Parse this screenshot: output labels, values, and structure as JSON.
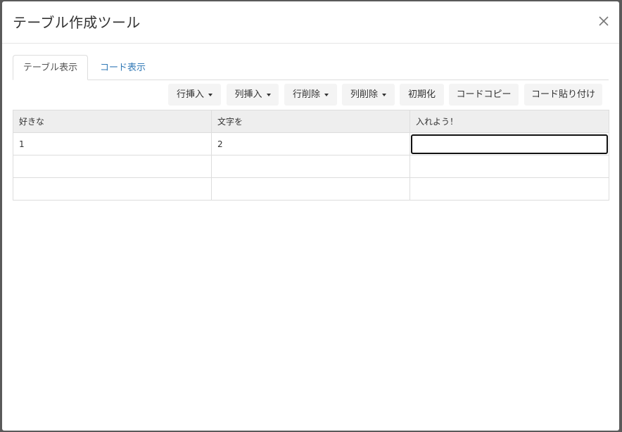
{
  "modal": {
    "title": "テーブル作成ツール"
  },
  "tabs": [
    {
      "label": "テーブル表示",
      "active": true
    },
    {
      "label": "コード表示",
      "active": false
    }
  ],
  "toolbar": {
    "insert_row": "行挿入",
    "insert_col": "列挿入",
    "delete_row": "行削除",
    "delete_col": "列削除",
    "reset": "初期化",
    "copy_code": "コードコピー",
    "paste_code": "コード貼り付け"
  },
  "table": {
    "rows": [
      [
        "好きな",
        "文字を",
        "入れよう！"
      ],
      [
        "1",
        "2",
        ""
      ],
      [
        "",
        "",
        ""
      ],
      [
        "",
        "",
        ""
      ]
    ],
    "active_cell_value": ""
  },
  "colors": {
    "link": "#337ab7",
    "header_bg": "#eeeeee",
    "button_bg": "#f4f4f4"
  },
  "icons": [
    "close-icon",
    "caret-down-icon"
  ]
}
